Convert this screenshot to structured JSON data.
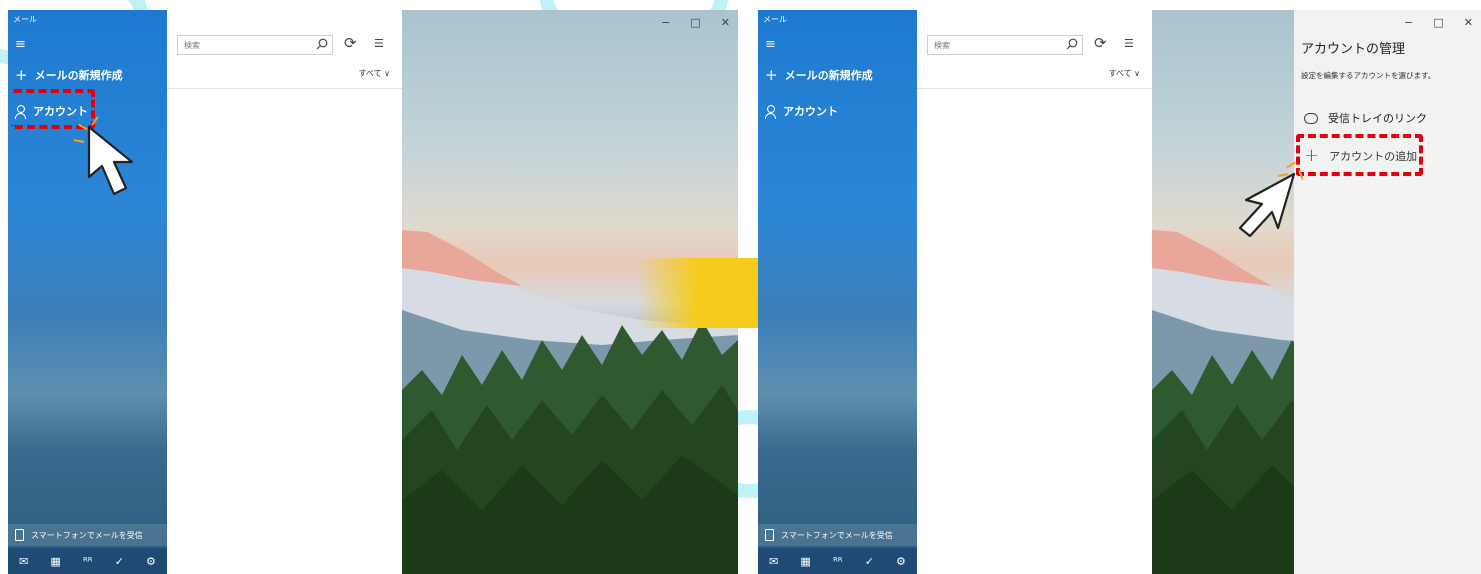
{
  "left_panel": {
    "app_title": "メール",
    "new_mail_label": "メールの新規作成",
    "account_label": "アカウント",
    "phone_label": "スマートフォンでメールを受信",
    "search_placeholder": "検索",
    "filter_label": "すべて ∨"
  },
  "right_panel": {
    "app_title": "メール",
    "new_mail_label": "メールの新規作成",
    "account_label": "アカウント",
    "phone_label": "スマートフォンでメールを受信",
    "search_placeholder": "検索",
    "filter_label": "すべて ∨",
    "manage": {
      "title": "アカウントの管理",
      "description": "設定を編集するアカウントを選びます。",
      "link_inbox_label": "受信トレイのリンク",
      "add_account_label": "アカウントの追加"
    }
  },
  "window_controls": {
    "minimize": "−",
    "maximize": "□",
    "close": "✕"
  },
  "colors": {
    "sidebar_blue": "#1e7ad0",
    "highlight_red": "#e3000b",
    "arrow_yellow": "#f5cc1c",
    "cursor_white": "#ffffff"
  }
}
